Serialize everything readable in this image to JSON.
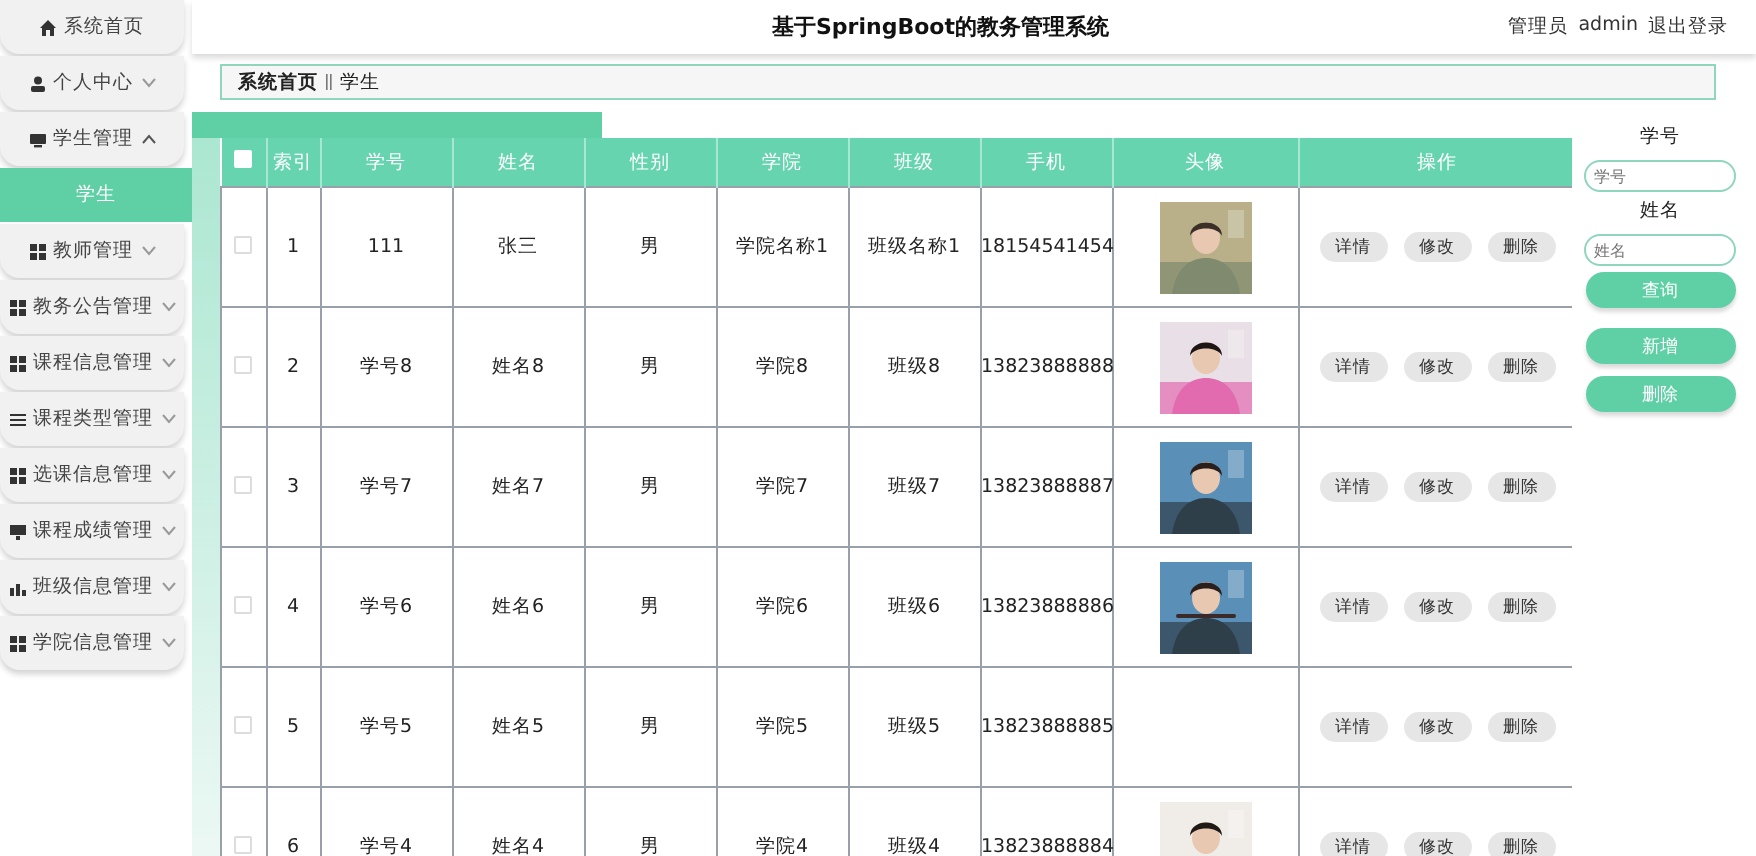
{
  "header": {
    "title": "基于SpringBoot的教务管理系统",
    "user_role": "管理员",
    "user_name": "admin",
    "logout": "退出登录"
  },
  "sidebar": {
    "items": [
      {
        "label": "系统首页"
      },
      {
        "label": "个人中心",
        "expanded": false
      },
      {
        "label": "学生管理",
        "expanded": true,
        "children": [
          {
            "label": "学生",
            "selected": true
          }
        ]
      },
      {
        "label": "教师管理",
        "expanded": false
      },
      {
        "label": "教务公告管理",
        "expanded": false
      },
      {
        "label": "课程信息管理",
        "expanded": false
      },
      {
        "label": "课程类型管理",
        "expanded": false
      },
      {
        "label": "选课信息管理",
        "expanded": false
      },
      {
        "label": "课程成绩管理",
        "expanded": false
      },
      {
        "label": "班级信息管理",
        "expanded": false
      },
      {
        "label": "学院信息管理",
        "expanded": false
      }
    ]
  },
  "breadcrumb": [
    "系统首页",
    "学生"
  ],
  "table": {
    "select_all": {
      "checked": false
    },
    "columns": [
      "索引",
      "学号",
      "姓名",
      "性别",
      "学院",
      "班级",
      "手机",
      "头像",
      "操作"
    ],
    "rows": [
      {
        "checked": false,
        "cells": [
          "1",
          "111",
          "张三",
          "男",
          "学院名称1",
          "班级名称1",
          "18154541454"
        ],
        "actions": [
          "详情",
          "修改",
          "删除"
        ]
      },
      {
        "checked": false,
        "cells": [
          "2",
          "学号8",
          "姓名8",
          "男",
          "学院8",
          "班级8",
          "13823888888"
        ],
        "actions": [
          "详情",
          "修改",
          "删除"
        ]
      },
      {
        "checked": false,
        "cells": [
          "3",
          "学号7",
          "姓名7",
          "男",
          "学院7",
          "班级7",
          "13823888887"
        ],
        "actions": [
          "详情",
          "修改",
          "删除"
        ]
      },
      {
        "checked": false,
        "cells": [
          "4",
          "学号6",
          "姓名6",
          "男",
          "学院6",
          "班级6",
          "13823888886"
        ],
        "actions": [
          "详情",
          "修改",
          "删除"
        ]
      },
      {
        "checked": false,
        "cells": [
          "5",
          "学号5",
          "姓名5",
          "男",
          "学院5",
          "班级5",
          "13823888885"
        ],
        "avatar": {
          "kind": "broken"
        },
        "actions": [
          "详情",
          "修改",
          "删除"
        ]
      },
      {
        "checked": false,
        "cells": [
          "6",
          "学号4",
          "姓名4",
          "男",
          "学院4",
          "班级4",
          "13823888884"
        ],
        "actions": [
          "详情",
          "修改",
          "删除"
        ]
      }
    ]
  },
  "search": {
    "fields": [
      {
        "label": "学号",
        "placeholder": "学号"
      },
      {
        "label": "姓名",
        "placeholder": "姓名"
      }
    ],
    "buttons": [
      "查询",
      "新增",
      "删除"
    ]
  }
}
